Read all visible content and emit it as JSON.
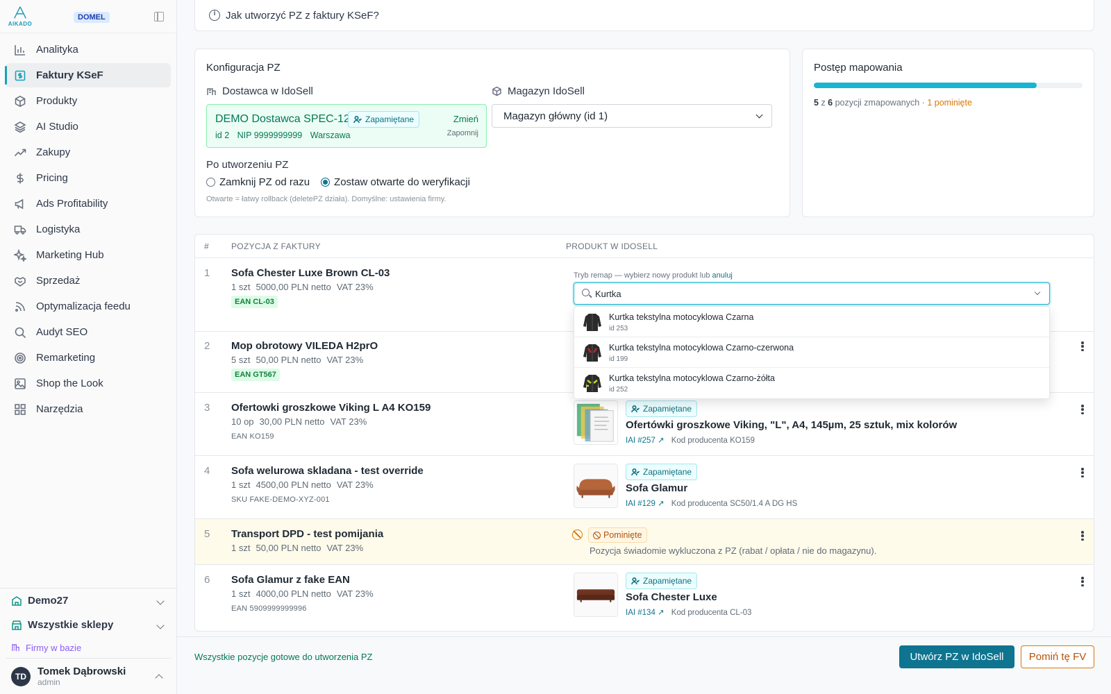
{
  "sidebar": {
    "logo_text": "AIKADO",
    "badge": "DOMEL",
    "items": [
      {
        "label": "Analityka",
        "icon": "bar-chart-icon"
      },
      {
        "label": "Faktury KSeF",
        "icon": "invoice-icon",
        "active": true
      },
      {
        "label": "Produkty",
        "icon": "package-icon"
      },
      {
        "label": "AI Studio",
        "icon": "layers-icon"
      },
      {
        "label": "Zakupy",
        "icon": "trending-up-icon"
      },
      {
        "label": "Pricing",
        "icon": "dollar-icon"
      },
      {
        "label": "Ads Profitability",
        "icon": "megaphone-icon"
      },
      {
        "label": "Logistyka",
        "icon": "truck-icon"
      },
      {
        "label": "Marketing Hub",
        "icon": "sparkles-icon"
      },
      {
        "label": "Sprzedaż",
        "icon": "handshake-icon"
      },
      {
        "label": "Optymalizacja feedu",
        "icon": "rss-icon"
      },
      {
        "label": "Audyt SEO",
        "icon": "search-icon"
      },
      {
        "label": "Remarketing",
        "icon": "target-icon"
      },
      {
        "label": "Shop the Look",
        "icon": "image-icon"
      },
      {
        "label": "Narzędzia",
        "icon": "grid-icon"
      }
    ],
    "company": "Demo27",
    "shops": "Wszystkie sklepy",
    "firmy": "Firmy w bazie",
    "user": {
      "initials": "TD",
      "name": "Tomek Dąbrowski",
      "role": "admin"
    }
  },
  "help": {
    "text": "Jak utworzyć PZ z faktury KSeF?"
  },
  "config": {
    "title": "Konfiguracja PZ",
    "supplier_label": "Dostawca w IdoSell",
    "supplier_name": "DEMO Dostawca SPEC-128",
    "remembered": "Zapamiętane",
    "supplier_id": "id 2",
    "supplier_nip": "NIP 9999999999",
    "supplier_city": "Warszawa",
    "change": "Zmień",
    "forget": "Zapomnij",
    "warehouse_label": "Magazyn IdoSell",
    "warehouse_value": "Magazyn główny (id 1)",
    "after_label": "Po utworzeniu PZ",
    "option_close": "Zamknij PZ od razu",
    "option_open": "Zostaw otwarte do weryfikacji",
    "hint": "Otwarte = łatwy rollback (deletePZ działa). Domyślne: ustawienia firmy."
  },
  "progress": {
    "title": "Postęp mapowania",
    "mapped": "5",
    "total": "6",
    "fraction": 0.83,
    "text_mid": "pozycji zmapowanych ·",
    "skipped": "1 pominięte",
    "z": "z"
  },
  "table": {
    "col_num": "#",
    "col_item": "POZYCJA Z FAKTURY",
    "col_product": "PRODUKT W IDOSELL",
    "rows": [
      {
        "num": "1",
        "name": "Sofa Chester Luxe Brown CL-03",
        "qty": "1 szt",
        "price": "5000,00 PLN netto",
        "vat": "VAT 23%",
        "code": "EAN CL-03"
      },
      {
        "num": "2",
        "name": "Mop obrotowy VILEDA H2prO",
        "qty": "5 szt",
        "price": "50,00 PLN netto",
        "vat": "VAT 23%",
        "code": "EAN GT567"
      },
      {
        "num": "3",
        "name": "Ofertowki groszkowe Viking L A4 KO159",
        "qty": "10 op",
        "price": "30,00 PLN netto",
        "vat": "VAT 23%",
        "code": "EAN KO159",
        "product": "Ofertówki groszkowe Viking, \"L\", A4, 145µm, 25 sztuk, mix kolorów",
        "iai": "IAI #257",
        "producer": "Kod producenta KO159",
        "remembered": "Zapamiętane"
      },
      {
        "num": "4",
        "name": "Sofa welurowa skladana - test override",
        "qty": "1 szt",
        "price": "4500,00 PLN netto",
        "vat": "VAT 23%",
        "code": "SKU FAKE-DEMO-XYZ-001",
        "product": "Sofa Glamur",
        "iai": "IAI #129",
        "producer": "Kod producenta SC50/1.4 A DG HS",
        "remembered": "Zapamiętane"
      },
      {
        "num": "5",
        "name": "Transport DPD - test pomijania",
        "qty": "1 szt",
        "price": "50,00 PLN netto",
        "vat": "VAT 23%",
        "skipped": "Pominięte",
        "skip_text": "Pozycja świadomie wykluczona z PZ (rabat / opłata / nie do magazynu)."
      },
      {
        "num": "6",
        "name": "Sofa Glamur z fake EAN",
        "qty": "1 szt",
        "price": "4000,00 PLN netto",
        "vat": "VAT 23%",
        "code": "EAN 5909999999996",
        "product": "Sofa Chester Luxe",
        "iai": "IAI #134",
        "producer": "Kod producenta CL-03",
        "remembered": "Zapamiętane"
      }
    ]
  },
  "remap": {
    "hint": "Tryb remap — wybierz nowy produkt lub",
    "cancel": "anuluj",
    "query": "Kurtka",
    "options": [
      {
        "name": "Kurtka tekstylna motocyklowa Czarna",
        "id": "id 253"
      },
      {
        "name": "Kurtka tekstylna motocyklowa Czarno-czerwona",
        "id": "id 199"
      },
      {
        "name": "Kurtka tekstylna motocyklowa Czarno-żółta",
        "id": "id 252"
      }
    ]
  },
  "footer": {
    "message": "Wszystkie pozycje gotowe do utworzenia PZ",
    "create": "Utwórz PZ w IdoSell",
    "skip": "Pomiń tę FV"
  },
  "colors": {
    "accent": "#0e7490",
    "progress": "#19b4d1",
    "success": "#047857",
    "warning": "#d97706"
  }
}
